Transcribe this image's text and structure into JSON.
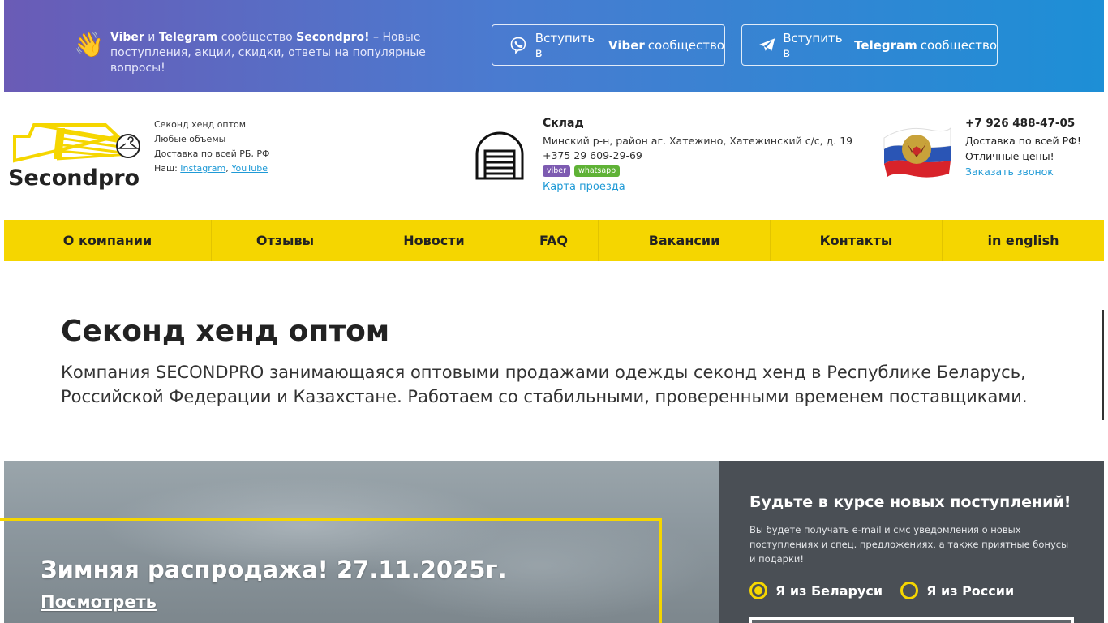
{
  "banner": {
    "intro_viber": "Viber",
    "intro_and": "и",
    "intro_telegram": "Telegram",
    "intro_community": "сообщество",
    "intro_brand": "Secondpro!",
    "intro_rest": "– Новые поступления, акции, скидки, ответы на популярные вопросы!",
    "viber_pre": "Вступить в",
    "viber_name": "Viber",
    "viber_post": "сообщество",
    "telegram_pre": "Вступить в",
    "telegram_name": "Telegram",
    "telegram_post": "сообщество"
  },
  "header": {
    "logo_text": "Secondpro",
    "tagline": [
      "Секонд хенд оптом",
      "Любые объемы",
      "Доставка по всей РБ, РФ"
    ],
    "social_prefix": "Наш:",
    "instagram": "Instagram",
    "youtube": "YouTube",
    "warehouse_title": "Склад",
    "warehouse_address": "Минский р-н, район аг. Хатежино, Хатежинский с/с, д. 19",
    "warehouse_phone": "+375 29 609-29-69",
    "badge_viber": "viber",
    "badge_whatsapp": "whatsapp",
    "map_link": "Карта проезда",
    "ru_phone": "+7 926 488-47-05",
    "ru_delivery": "Доставка по всей РФ!",
    "ru_prices": "Отличные цены!",
    "callback": "Заказать звонок"
  },
  "nav": {
    "items": [
      "О компании",
      "Отзывы",
      "Новости",
      "FAQ",
      "Вакансии",
      "Контакты",
      "in english"
    ]
  },
  "main": {
    "title": "Секонд хенд оптом",
    "lead": "Компания SECONDPRO занимающаяся оптовыми продажами одежды секонд хенд в Республике Беларусь, Российской Федерации и Казахстане. Работаем со стабильными, проверенными временем поставщиками."
  },
  "hero": {
    "title": "Зимняя распродажа! 27.11.2025г.",
    "link": "Посмотреть"
  },
  "subscribe": {
    "title": "Будьте в курсе новых поступлений!",
    "text": "Вы будете получать e-mail и смс уведомления о новых поступлениях и спец. предложениях, а также приятные бонусы и подарки!",
    "radio_by": "Я из Беларуси",
    "radio_ru": "Я из России"
  },
  "colors": {
    "accent_yellow": "#f5d600",
    "link_blue": "#1f9ad6",
    "viber_purple": "#7d5bb1",
    "whatsapp_green": "#5fb236"
  }
}
